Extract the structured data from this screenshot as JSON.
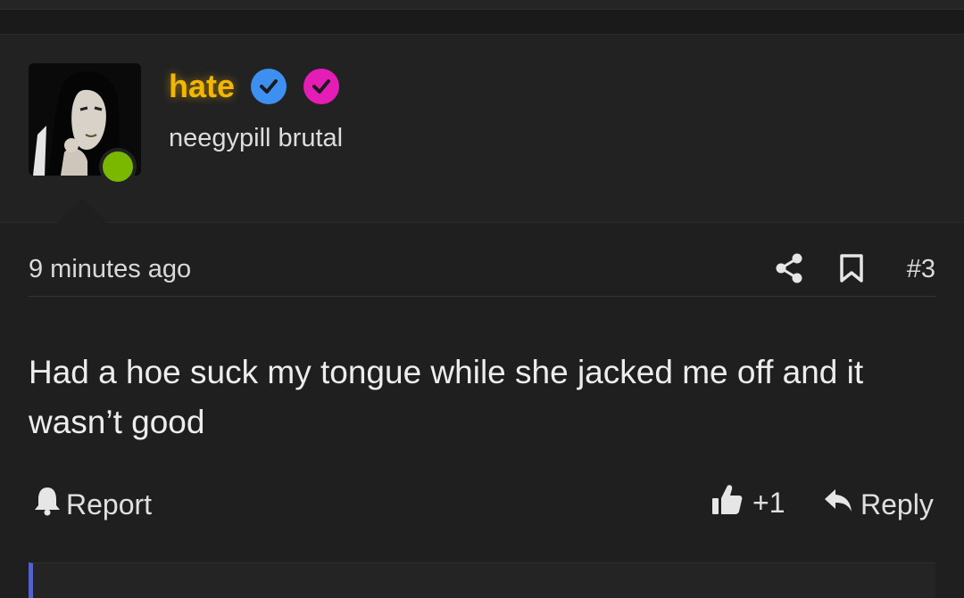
{
  "user": {
    "name": "hate",
    "title": "neegypill brutal",
    "avatar_icon": "user-avatar-photo",
    "online": true,
    "badges": [
      {
        "icon": "verified-check-icon",
        "color": "#3d8ff0"
      },
      {
        "icon": "verified-check-icon",
        "color": "#e61cb7"
      }
    ],
    "name_color": "#f2b705"
  },
  "post": {
    "time": "9 minutes ago",
    "number": "#3",
    "body": "Had a hoe suck my tongue while she jacked me off and it wasn’t good"
  },
  "actions": {
    "report_label": "Report",
    "like_count": "+1",
    "reply_label": "Reply"
  },
  "colors": {
    "background": "#1f1f1f",
    "online": "#7ab800",
    "quote_accent": "#5560c8"
  }
}
